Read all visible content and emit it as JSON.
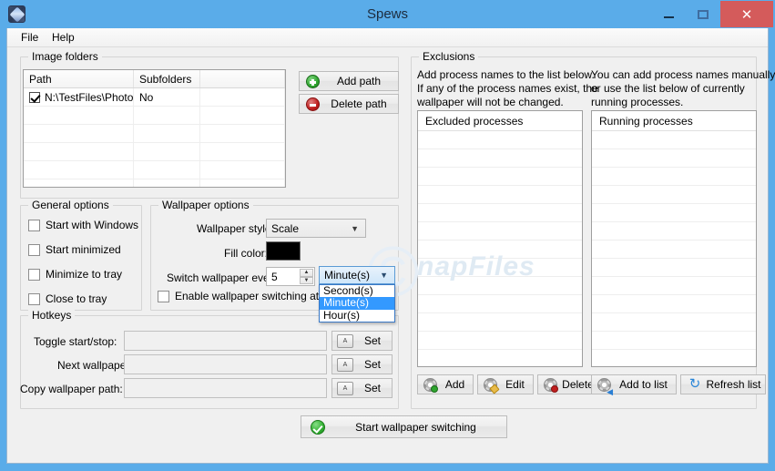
{
  "window": {
    "title": "Spews",
    "icon": "app-diamond-icon",
    "controls": {
      "minimize": "–",
      "maximize": "□",
      "close": "✕"
    }
  },
  "menubar": {
    "items": [
      {
        "label": "File"
      },
      {
        "label": "Help"
      }
    ]
  },
  "image_folders": {
    "group_label": "Image folders",
    "columns": [
      "Path",
      "Subfolders",
      ""
    ],
    "rows": [
      {
        "checked": true,
        "path": "N:\\TestFiles\\Photos",
        "subfolders": "No"
      }
    ],
    "buttons": [
      {
        "label": "Add path",
        "icon": "plus-circle-icon"
      },
      {
        "label": "Delete path",
        "icon": "minus-circle-icon"
      }
    ]
  },
  "general_options": {
    "group_label": "General options",
    "checkboxes": [
      {
        "label": "Start with Windows",
        "checked": false
      },
      {
        "label": "Start minimized",
        "checked": false
      },
      {
        "label": "Minimize to tray",
        "checked": false
      },
      {
        "label": "Close to tray",
        "checked": false
      }
    ]
  },
  "wallpaper_options": {
    "group_label": "Wallpaper options",
    "style_label": "Wallpaper style:",
    "style_value": "Scale",
    "fill_color_label": "Fill color:",
    "fill_color_value": "#000000",
    "switch_label": "Switch wallpaper every:",
    "switch_value": "5",
    "unit_value": "Minute(s)",
    "unit_options": [
      {
        "label": "Second(s)",
        "selected": false
      },
      {
        "label": "Minute(s)",
        "selected": true
      },
      {
        "label": "Hour(s)",
        "selected": false
      }
    ],
    "startup_checkbox": {
      "label": "Enable wallpaper switching at startup",
      "checked": false
    }
  },
  "hotkeys": {
    "group_label": "Hotkeys",
    "rows": [
      {
        "label": "Toggle start/stop:",
        "value": "",
        "button": "Set"
      },
      {
        "label": "Next wallpaper:",
        "value": "",
        "button": "Set"
      },
      {
        "label": "Copy wallpaper path:",
        "value": "",
        "button": "Set"
      }
    ],
    "key_icon_glyph": "A"
  },
  "exclusions": {
    "group_label": "Exclusions",
    "left_description": "Add process names to the list below. If any of the process names exist, the wallpaper will not be changed.",
    "left_description_lines": [
      "Add process names to the list below.",
      "If any of the process names exist, the",
      "wallpaper will not be changed."
    ],
    "right_description_lines": [
      "You can add process names manually",
      "or use the list below of currently",
      "running processes."
    ],
    "excluded_header": "Excluded processes",
    "running_header": "Running processes",
    "excluded_items": [],
    "running_items": [],
    "left_buttons": [
      {
        "label": "Add",
        "icon": "gear-add-icon"
      },
      {
        "label": "Edit",
        "icon": "gear-edit-icon"
      },
      {
        "label": "Delete",
        "icon": "gear-delete-icon"
      }
    ],
    "right_buttons": [
      {
        "label": "Add to list",
        "icon": "gear-arrow-icon"
      },
      {
        "label": "Refresh list",
        "icon": "refresh-icon"
      }
    ]
  },
  "start_button": {
    "label": "Start wallpaper switching",
    "icon": "green-check-icon"
  },
  "watermark": {
    "text": "napFiles",
    "mark": "©"
  },
  "colors": {
    "titlebar": "#5aace9",
    "close_button": "#d45b5b",
    "client": "#f0f0f0",
    "accent_selection": "#3399ff",
    "fill_color": "#000000"
  }
}
